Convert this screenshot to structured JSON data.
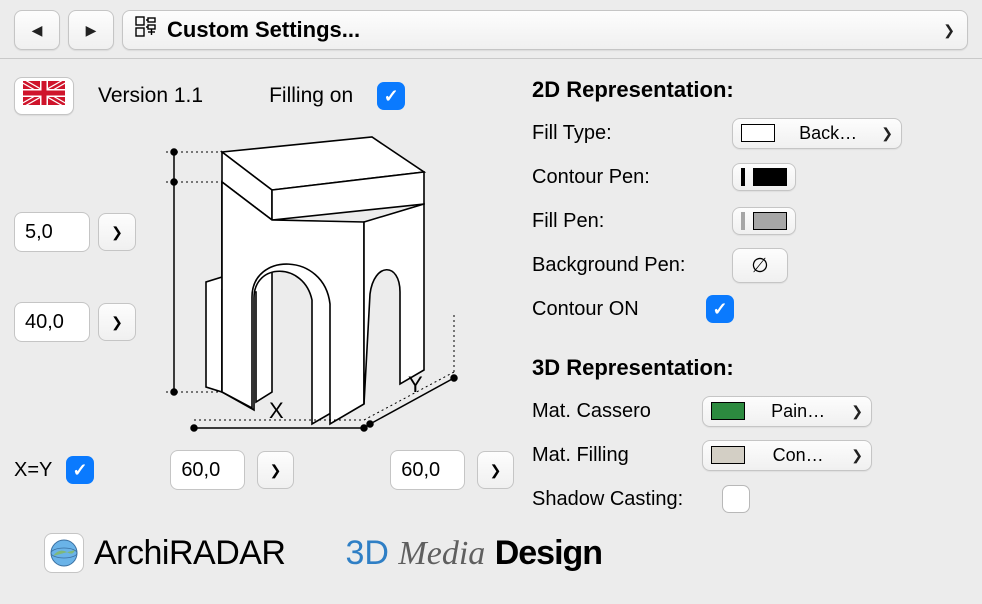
{
  "toolbar": {
    "title": "Custom Settings..."
  },
  "header": {
    "version": "Version 1.1",
    "filling_label": "Filling on"
  },
  "dims": {
    "top_thickness": "5,0",
    "height": "40,0",
    "x": "60,0",
    "y": "60,0",
    "xy_equal_label": "X=Y",
    "x_axis": "X",
    "y_axis": "Y"
  },
  "rep2d": {
    "heading": "2D Representation:",
    "fill_type_label": "Fill Type:",
    "fill_type_value": "Back…",
    "contour_pen_label": "Contour Pen:",
    "fill_pen_label": "Fill Pen:",
    "bg_pen_label": "Background Pen:",
    "contour_on_label": "Contour ON"
  },
  "rep3d": {
    "heading": "3D Representation:",
    "mat_cassero_label": "Mat. Cassero",
    "mat_cassero_value": "Pain…",
    "mat_filling_label": "Mat. Filling",
    "mat_filling_value": "Con…",
    "shadow_label": "Shadow Casting:"
  },
  "logos": {
    "archiradar": "ArchiRADAR",
    "md_3d": "3D",
    "md_media": "Media",
    "md_design": "Design"
  },
  "colors": {
    "accent": "#0a7afe",
    "mat_green": "#2c8a3f",
    "mat_tan": "#d3cfc5"
  }
}
